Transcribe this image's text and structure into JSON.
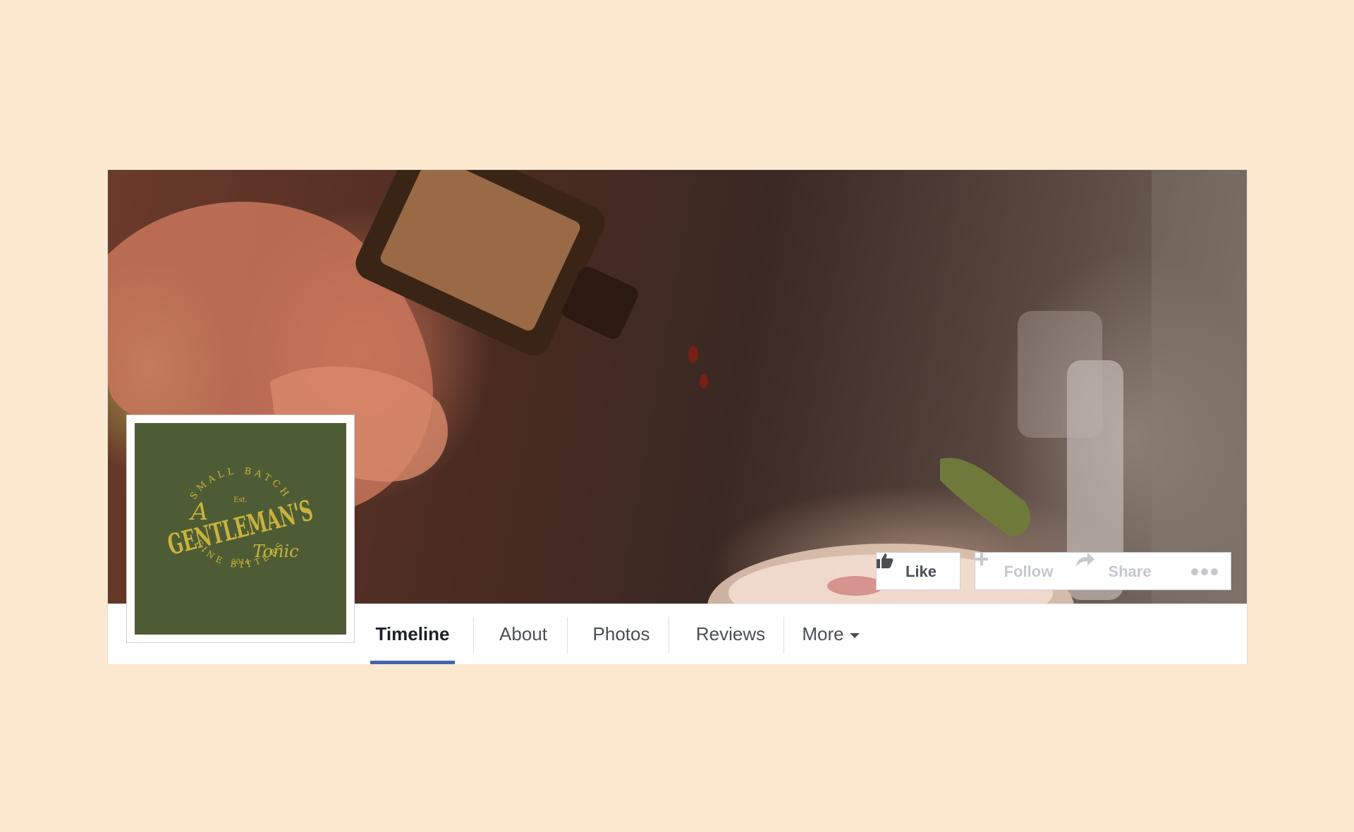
{
  "tabs": {
    "timeline": "Timeline",
    "about": "About",
    "photos": "Photos",
    "reviews": "Reviews",
    "more": "More"
  },
  "actions": {
    "like": "Like",
    "follow": "Follow",
    "share": "Share"
  },
  "profile_logo": {
    "arc_top": "SMALL BATCH",
    "est": "Est.",
    "prefix": "A",
    "name": "GENTLEMAN'S",
    "suffix": "Tonic",
    "year": "2014",
    "arc_bottom": "FINE BITTERS"
  },
  "colors": {
    "logo_background": "#4e5c35",
    "logo_text": "#c9b33d",
    "tab_active_underline": "#4267b2",
    "page_background": "#fde9cf"
  },
  "icons": {
    "like": "thumbs-up-icon",
    "follow": "plus-icon",
    "share": "share-arrow-icon",
    "more": "ellipsis-icon"
  }
}
